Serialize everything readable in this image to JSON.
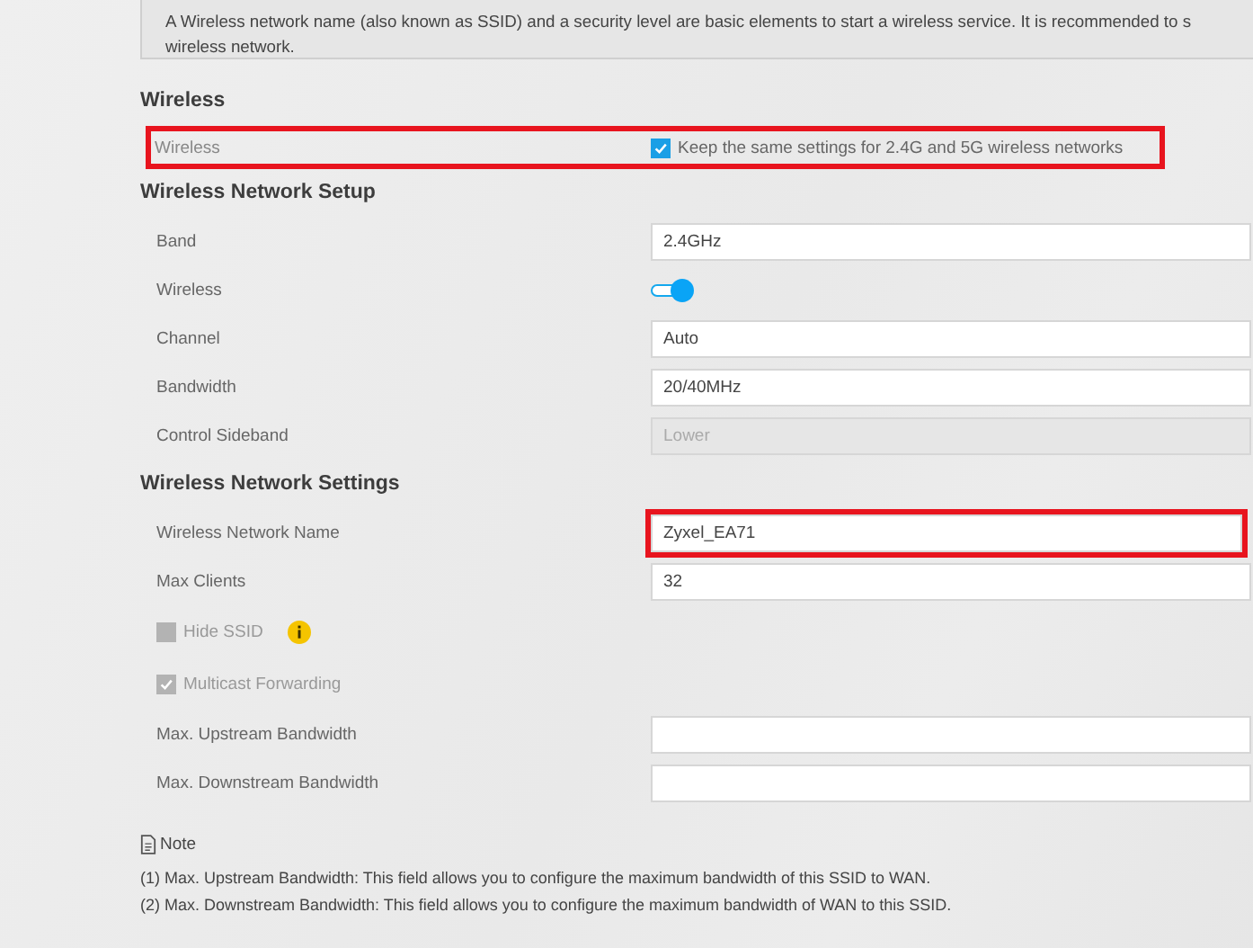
{
  "intro": {
    "lines": [
      "A Wireless network name (also known as SSID) and a security level are basic elements to start a wireless service. It is recommended to s",
      "wireless network."
    ]
  },
  "sections": [
    {
      "title": "Wireless",
      "rows": [
        {
          "kind": "check-right",
          "label": "Wireless",
          "text": "Keep the same settings for 2.4G and 5G wireless networks",
          "checked": true,
          "highlighted": true
        }
      ]
    },
    {
      "title": "Wireless Network Setup",
      "rows": [
        {
          "kind": "input",
          "label": "Band",
          "value": "2.4GHz",
          "disabled": false,
          "highlighted": false
        },
        {
          "kind": "toggle",
          "label": "Wireless",
          "on": true
        },
        {
          "kind": "input",
          "label": "Channel",
          "value": "Auto",
          "disabled": false,
          "highlighted": false
        },
        {
          "kind": "input",
          "label": "Bandwidth",
          "value": "20/40MHz",
          "disabled": false,
          "highlighted": false
        },
        {
          "kind": "input",
          "label": "Control Sideband",
          "value": "Lower",
          "disabled": true,
          "highlighted": false
        }
      ]
    },
    {
      "title": "Wireless Network Settings",
      "rows": [
        {
          "kind": "input",
          "label": "Wireless Network Name",
          "value": "Zyxel_EA71",
          "disabled": false,
          "highlighted": true
        },
        {
          "kind": "input",
          "label": "Max Clients",
          "value": "32",
          "disabled": false,
          "highlighted": false
        },
        {
          "kind": "checkbox",
          "label": "Hide SSID",
          "checked": false,
          "info": true
        },
        {
          "kind": "checkbox",
          "label": "Multicast Forwarding",
          "checked": true,
          "info": false
        },
        {
          "kind": "input",
          "label": "Max. Upstream Bandwidth",
          "value": "",
          "disabled": false,
          "highlighted": false
        },
        {
          "kind": "input",
          "label": "Max. Downstream Bandwidth",
          "value": "",
          "disabled": false,
          "highlighted": false
        }
      ]
    }
  ],
  "note": {
    "title": "Note",
    "lines": [
      "(1) Max. Upstream Bandwidth: This field allows you to configure the maximum bandwidth of this SSID to WAN.",
      "(2) Max. Downstream Bandwidth: This field allows you to configure the maximum bandwidth of WAN to this SSID."
    ]
  }
}
